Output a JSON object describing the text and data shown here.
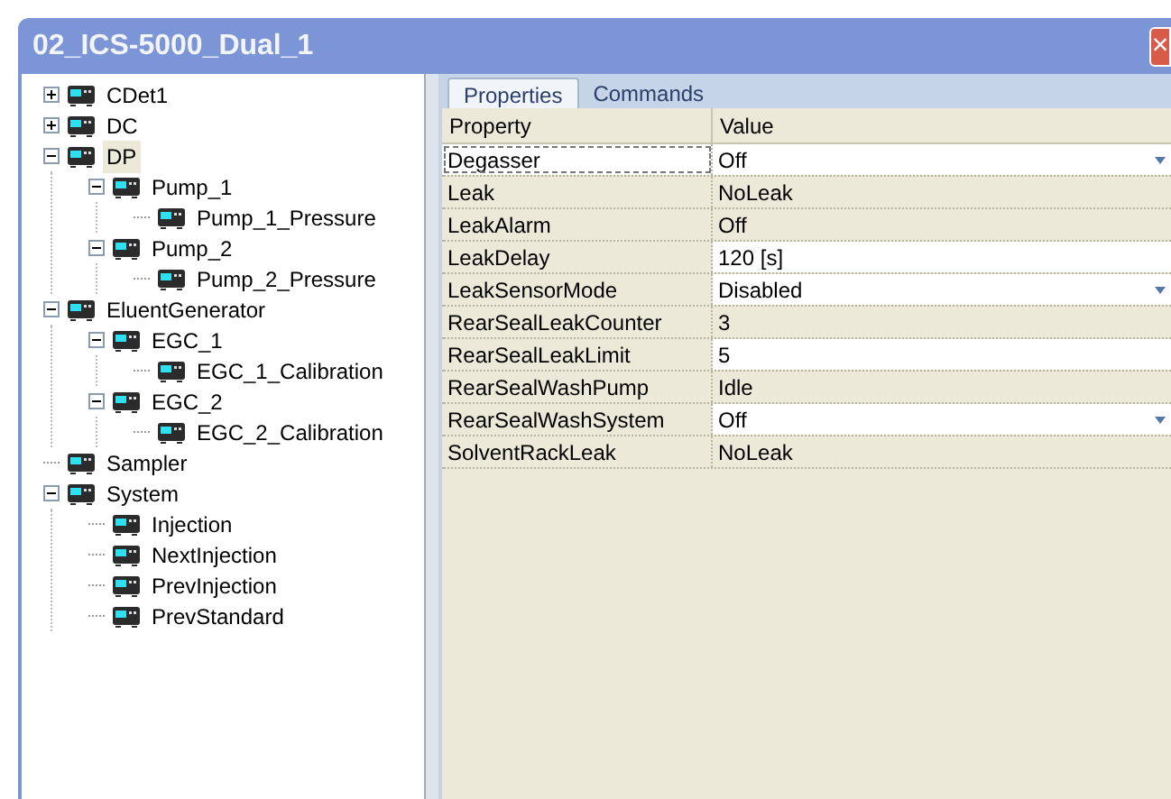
{
  "window": {
    "title": "02_ICS-5000_Dual_1",
    "close": "×"
  },
  "tree": [
    {
      "label": "CDet1",
      "expanded": false,
      "selected": false
    },
    {
      "label": "DC",
      "expanded": false,
      "selected": false
    },
    {
      "label": "DP",
      "expanded": true,
      "selected": true,
      "children": [
        {
          "label": "Pump_1",
          "expanded": true,
          "selected": false,
          "children": [
            {
              "label": "Pump_1_Pressure",
              "selected": false
            }
          ]
        },
        {
          "label": "Pump_2",
          "expanded": true,
          "selected": false,
          "children": [
            {
              "label": "Pump_2_Pressure",
              "selected": false
            }
          ]
        }
      ]
    },
    {
      "label": "EluentGenerator",
      "expanded": true,
      "selected": false,
      "children": [
        {
          "label": "EGC_1",
          "expanded": true,
          "selected": false,
          "children": [
            {
              "label": "EGC_1_Calibration",
              "selected": false
            }
          ]
        },
        {
          "label": "EGC_2",
          "expanded": true,
          "selected": false,
          "children": [
            {
              "label": "EGC_2_Calibration",
              "selected": false
            }
          ]
        }
      ]
    },
    {
      "label": "Sampler",
      "selected": false
    },
    {
      "label": "System",
      "expanded": true,
      "selected": false,
      "children": [
        {
          "label": "Injection",
          "selected": false
        },
        {
          "label": "NextInjection",
          "selected": false
        },
        {
          "label": "PrevInjection",
          "selected": false
        },
        {
          "label": "PrevStandard",
          "selected": false
        }
      ]
    }
  ],
  "tabs": [
    {
      "label": "Properties",
      "selected": true
    },
    {
      "label": "Commands",
      "selected": false
    }
  ],
  "table": {
    "columns": [
      "Property",
      "Value"
    ],
    "rows": [
      {
        "property": "Degasser",
        "value": "Off",
        "editable": true,
        "dropdown": true,
        "selected": true
      },
      {
        "property": "Leak",
        "value": "NoLeak",
        "editable": false,
        "dropdown": false,
        "selected": false
      },
      {
        "property": "LeakAlarm",
        "value": "Off",
        "editable": false,
        "dropdown": false,
        "selected": false
      },
      {
        "property": "LeakDelay",
        "value": "120 [s]",
        "editable": true,
        "dropdown": false,
        "selected": false
      },
      {
        "property": "LeakSensorMode",
        "value": "Disabled",
        "editable": true,
        "dropdown": true,
        "selected": false
      },
      {
        "property": "RearSealLeakCounter",
        "value": "3",
        "editable": false,
        "dropdown": false,
        "selected": false
      },
      {
        "property": "RearSealLeakLimit",
        "value": "5",
        "editable": true,
        "dropdown": false,
        "selected": false
      },
      {
        "property": "RearSealWashPump",
        "value": "Idle",
        "editable": false,
        "dropdown": false,
        "selected": false
      },
      {
        "property": "RearSealWashSystem",
        "value": "Off",
        "editable": true,
        "dropdown": true,
        "selected": false
      },
      {
        "property": "SolventRackLeak",
        "value": "NoLeak",
        "editable": false,
        "dropdown": false,
        "selected": false
      }
    ]
  }
}
